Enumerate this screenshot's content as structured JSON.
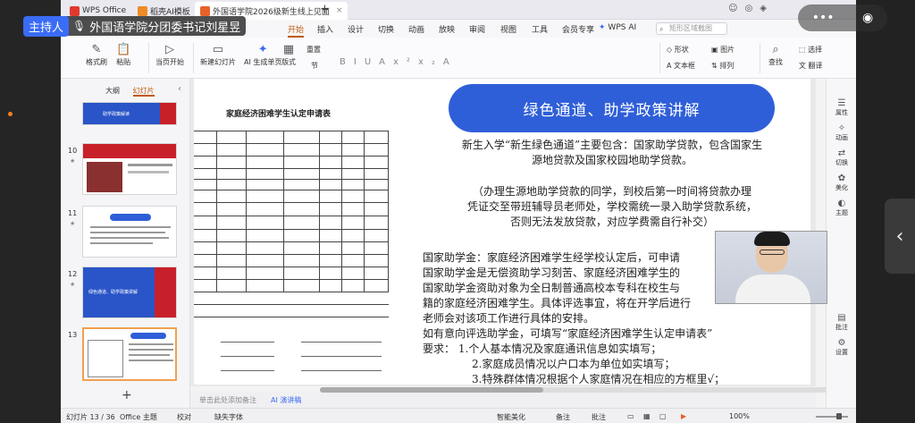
{
  "speaker": {
    "role": "主持人",
    "name": "外国语学院分团委书记刘星昱"
  },
  "titlebar": {
    "tabs": [
      {
        "label": "WPS Office"
      },
      {
        "label": "稻壳AI模板"
      },
      {
        "label": "外国语学院2026级新生线上见面"
      }
    ]
  },
  "menu": {
    "items": [
      "开始",
      "插入",
      "设计",
      "切换",
      "动画",
      "放映",
      "审阅",
      "视图",
      "工具",
      "会员专享"
    ],
    "active": "开始",
    "wpsai": "WPS AI",
    "search_placeholder": "矩形区域截图"
  },
  "toolbar": {
    "format_painter": "格式刷",
    "paste": "粘贴",
    "from_current": "当页开始",
    "new_slide": "新建幻灯片",
    "ai_gen": "AI 生成单页",
    "layout": "版式",
    "section": "节",
    "reset": "重置",
    "shape": "形状",
    "picture": "图片",
    "textbox": "文本框",
    "arrange": "排列",
    "find": "查找",
    "select": "选择",
    "translate": "翻译"
  },
  "left_panel": {
    "tab_outline": "大纲",
    "tab_slides": "幻灯片",
    "slides": [
      {
        "num": "",
        "title": "助学政策解读"
      },
      {
        "num": "10",
        "title": ""
      },
      {
        "num": "11",
        "title": ""
      },
      {
        "num": "12",
        "title": "绿色通道、助学政策讲解"
      },
      {
        "num": "13",
        "title": ""
      }
    ]
  },
  "slide": {
    "form_title": "家庭经济困难学生认定申请表",
    "banner": "绿色通道、助学政策讲解",
    "paragraphs": [
      "新生入学“新生绿色通道”主要包含：国家助学贷款，包含国家生",
      "源地贷款及国家校园地助学贷款。",
      "（办理生源地助学贷款的同学，到校后第一时间将贷款办理",
      "凭证交至带班辅导员老师处，学校需统一录入助学贷款系统，",
      "否则无法发放贷款，对应学费需自行补交）",
      "国家助学金：家庭经济困难学生经学校认定后，可申请",
      "国家助学金是无偿资助学习刻苦、家庭经济困难学生的",
      "国家助学金资助对象为全日制普通高校本专科在校生与",
      "籍的家庭经济困难学生。具体评选事宜，将在开学后进行",
      "老师会对该项工作进行具体的安排。",
      "如有意向评选助学金，可填写“家庭经济困难学生认定申请表”",
      "要求：  1.个人基本情况及家庭通讯信息如实填写；",
      "2.家庭成员情况以户口本为单位如实填写；",
      "3.特殊群体情况根据个人家庭情况在相应的方框里√；"
    ]
  },
  "notes": {
    "placeholder": "单击此处添加备注",
    "ai": "AI 演讲稿"
  },
  "rightbar": [
    "属性",
    "动画",
    "切换",
    "美化",
    "主题",
    "批注",
    "设置"
  ],
  "status": {
    "slide_counter": "幻灯片 13 / 36",
    "theme": "Office 主题",
    "proof": "校对",
    "missing_font": "缺失字体",
    "beautify": "智能美化",
    "notes": "备注",
    "comments": "批注",
    "zoom": "100%"
  }
}
